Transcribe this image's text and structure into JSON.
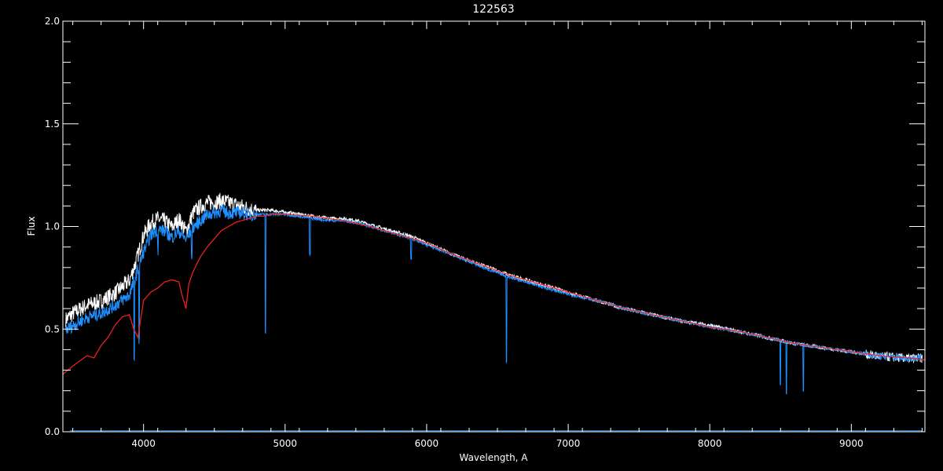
{
  "chart_data": {
    "type": "line",
    "title": "122563",
    "xlabel": "Wavelength, A",
    "ylabel": "Flux",
    "xlim": [
      3430,
      9520
    ],
    "ylim": [
      0.0,
      2.0
    ],
    "x_ticks": [
      4000,
      5000,
      6000,
      7000,
      8000,
      9000
    ],
    "x_tick_labels": [
      "4000",
      "5000",
      "6000",
      "7000",
      "8000",
      "9000"
    ],
    "y_ticks": [
      0.0,
      0.5,
      1.0,
      1.5,
      2.0
    ],
    "y_tick_labels": [
      "0.0",
      "0.5",
      "1.0",
      "1.5",
      "2.0"
    ],
    "background": "#000000",
    "axis_color": "#ffffff",
    "series": [
      {
        "color": "#ffffff",
        "noise": 0.05,
        "x": [
          3450,
          3500,
          3600,
          3700,
          3800,
          3900,
          3950,
          4000,
          4050,
          4100,
          4150,
          4200,
          4250,
          4300,
          4350,
          4400,
          4450,
          4500,
          4550,
          4600,
          4650,
          4700,
          4750,
          4800,
          4900,
          5000,
          5100,
          5200,
          5300,
          5400,
          5500,
          5600,
          5700,
          5800,
          5900,
          6000,
          6200,
          6400,
          6600,
          6800,
          7000,
          7200,
          7400,
          7600,
          7800,
          8000,
          8200,
          8400,
          8600,
          8800,
          9000,
          9200,
          9400,
          9500
        ],
        "y": [
          0.55,
          0.58,
          0.62,
          0.64,
          0.68,
          0.74,
          0.84,
          0.96,
          1.02,
          1.04,
          1.03,
          1.0,
          1.04,
          0.98,
          1.07,
          1.1,
          1.12,
          1.12,
          1.13,
          1.12,
          1.11,
          1.1,
          1.09,
          1.08,
          1.08,
          1.07,
          1.06,
          1.05,
          1.04,
          1.04,
          1.03,
          1.01,
          0.99,
          0.97,
          0.95,
          0.92,
          0.86,
          0.81,
          0.76,
          0.72,
          0.68,
          0.64,
          0.6,
          0.57,
          0.54,
          0.52,
          0.49,
          0.46,
          0.43,
          0.41,
          0.39,
          0.37,
          0.36,
          0.36
        ]
      },
      {
        "color": "#1e90ff",
        "noise": 0.04,
        "x": [
          3450,
          3500,
          3600,
          3700,
          3800,
          3900,
          3950,
          4000,
          4050,
          4100,
          4150,
          4200,
          4250,
          4300,
          4350,
          4400,
          4450,
          4500,
          4550,
          4600,
          4650,
          4700,
          4750,
          4800,
          4900,
          5000,
          5100,
          5200,
          5300,
          5400,
          5500,
          5600,
          5700,
          5800,
          5900,
          6000,
          6200,
          6400,
          6600,
          6800,
          7000,
          7200,
          7400,
          7600,
          7800,
          8000,
          8200,
          8400,
          8600,
          8800,
          9000,
          9200,
          9400,
          9500
        ],
        "y": [
          0.5,
          0.52,
          0.56,
          0.58,
          0.62,
          0.67,
          0.77,
          0.88,
          0.96,
          0.99,
          0.98,
          0.95,
          0.98,
          0.94,
          1.0,
          1.03,
          1.06,
          1.07,
          1.08,
          1.07,
          1.07,
          1.07,
          1.06,
          1.06,
          1.06,
          1.06,
          1.05,
          1.04,
          1.03,
          1.03,
          1.02,
          1.0,
          0.98,
          0.96,
          0.94,
          0.91,
          0.86,
          0.8,
          0.75,
          0.71,
          0.67,
          0.64,
          0.6,
          0.57,
          0.54,
          0.51,
          0.49,
          0.46,
          0.43,
          0.41,
          0.39,
          0.37,
          0.36,
          0.36
        ]
      },
      {
        "color": "#ff2020",
        "noise": 0,
        "x": [
          3430,
          3500,
          3600,
          3650,
          3700,
          3750,
          3800,
          3850,
          3900,
          3930,
          3960,
          4000,
          4050,
          4100,
          4150,
          4200,
          4250,
          4270,
          4300,
          4320,
          4350,
          4400,
          4450,
          4500,
          4550,
          4600,
          4650,
          4700,
          4750,
          4800,
          4850,
          4900,
          5000,
          5200,
          5400,
          5600,
          5800,
          6000,
          6200,
          6400,
          6600,
          6800,
          7000,
          7200,
          7400,
          7600,
          7800,
          8000,
          8200,
          8400,
          8600,
          8800,
          9000,
          9200,
          9400,
          9520
        ],
        "y": [
          0.28,
          0.32,
          0.37,
          0.36,
          0.42,
          0.46,
          0.52,
          0.56,
          0.57,
          0.5,
          0.46,
          0.64,
          0.68,
          0.7,
          0.73,
          0.74,
          0.73,
          0.67,
          0.6,
          0.72,
          0.78,
          0.85,
          0.9,
          0.94,
          0.98,
          1.0,
          1.02,
          1.03,
          1.04,
          1.05,
          1.05,
          1.06,
          1.06,
          1.05,
          1.03,
          1.0,
          0.96,
          0.92,
          0.86,
          0.81,
          0.76,
          0.72,
          0.68,
          0.64,
          0.6,
          0.57,
          0.54,
          0.51,
          0.49,
          0.46,
          0.43,
          0.41,
          0.39,
          0.37,
          0.36,
          0.35
        ]
      }
    ],
    "absorption_lines": [
      {
        "x": 3934,
        "depth": 0.4
      },
      {
        "x": 3968,
        "depth": 0.36
      },
      {
        "x": 4102,
        "depth": 0.1
      },
      {
        "x": 4340,
        "depth": 0.12
      },
      {
        "x": 4861,
        "depth": 0.58
      },
      {
        "x": 5175,
        "depth": 0.18
      },
      {
        "x": 5890,
        "depth": 0.1
      },
      {
        "x": 6563,
        "depth": 0.42
      },
      {
        "x": 8498,
        "depth": 0.22
      },
      {
        "x": 8542,
        "depth": 0.25
      },
      {
        "x": 8662,
        "depth": 0.22
      }
    ]
  }
}
